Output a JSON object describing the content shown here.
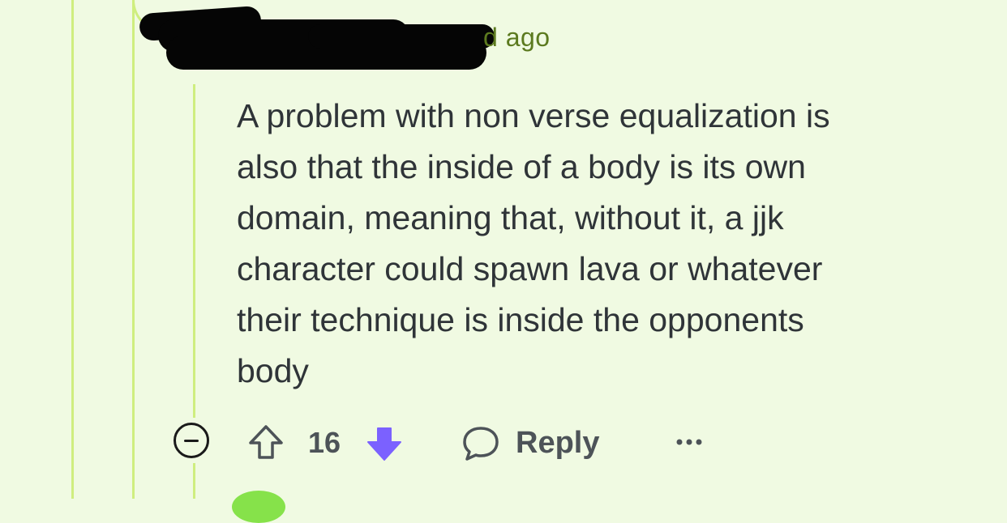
{
  "comment": {
    "time_label": "d ago",
    "body": "A problem with non verse equalization is\nalso that the inside of a body is its own\ndomain, meaning that, without it, a jjk\ncharacter could spawn lava or whatever\ntheir technique is inside the opponents\nbody",
    "vote_count": "16",
    "reply_label": "Reply"
  },
  "icons": {
    "collapse": "collapse-minus-icon",
    "upvote": "upvote-arrow-icon",
    "downvote": "downvote-arrow-icon",
    "reply": "speech-bubble-icon",
    "more": "more-dots-icon"
  },
  "colors": {
    "background": "#f0fae2",
    "thread_line": "#cfee7f",
    "time_text": "#5c7a1f",
    "body_text": "#2f3438",
    "downvote_active": "#7b61ff",
    "avatar": "#86e24a"
  }
}
